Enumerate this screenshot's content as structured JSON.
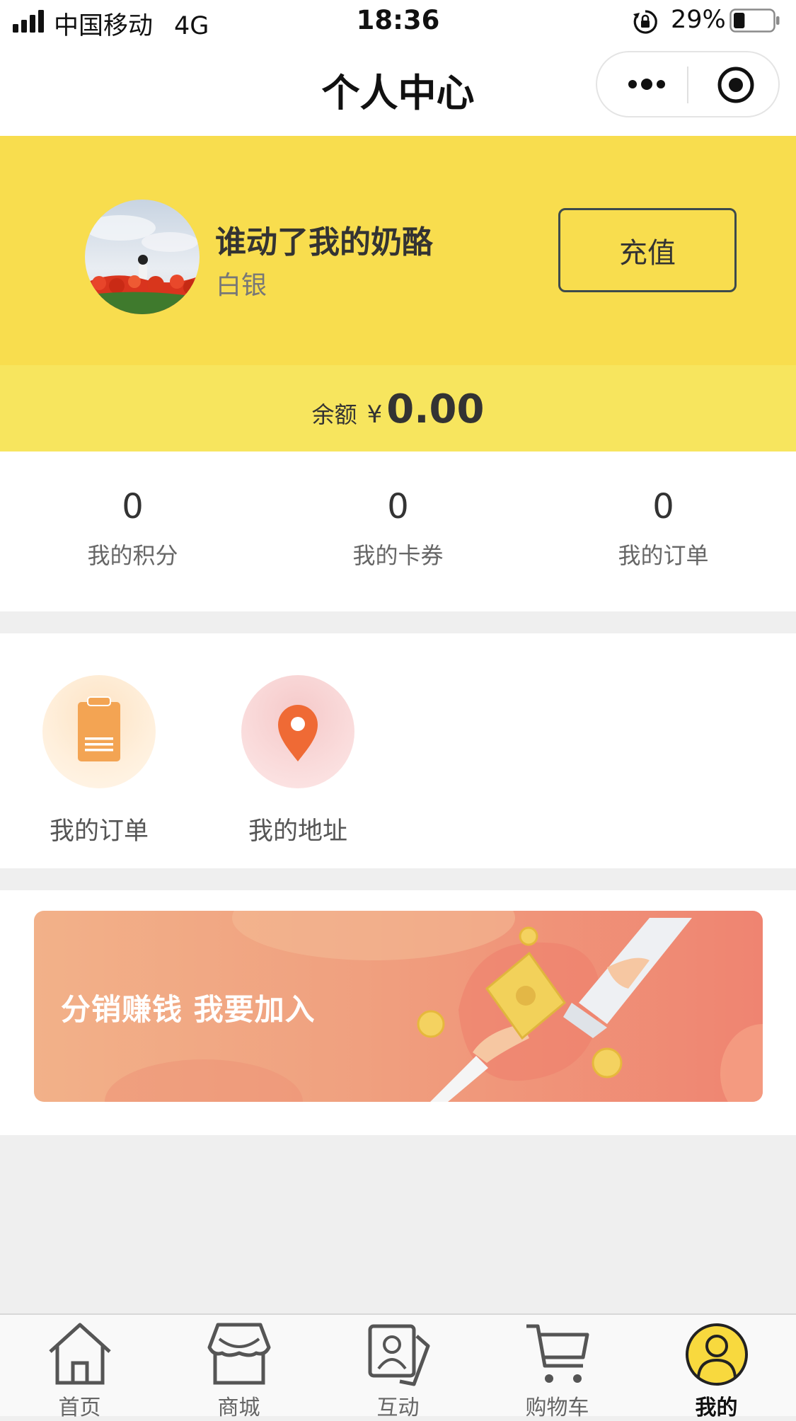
{
  "status_bar": {
    "carrier": "中国移动",
    "network": "4G",
    "time": "18:36",
    "battery": "29%",
    "battery_level": 0.29
  },
  "nav": {
    "title": "个人中心",
    "more_icon": "more-dots-icon",
    "close_icon": "target-circle-icon"
  },
  "profile": {
    "username": "谁动了我的奶酪",
    "level": "白银",
    "recharge_label": "充值",
    "balance_label": "余额",
    "currency": "¥",
    "balance_value": "0.00"
  },
  "stats": [
    {
      "value": "0",
      "label": "我的积分"
    },
    {
      "value": "0",
      "label": "我的卡券"
    },
    {
      "value": "0",
      "label": "我的订单"
    }
  ],
  "shortcuts": [
    {
      "label": "我的订单",
      "icon": "clipboard-icon"
    },
    {
      "label": "我的地址",
      "icon": "location-pin-icon"
    }
  ],
  "banner": {
    "text": "分销赚钱  我要加入"
  },
  "tabs": [
    {
      "label": "首页",
      "icon": "home-icon",
      "active": false
    },
    {
      "label": "商城",
      "icon": "store-icon",
      "active": false
    },
    {
      "label": "互动",
      "icon": "contact-card-icon",
      "active": false
    },
    {
      "label": "购物车",
      "icon": "cart-icon",
      "active": false
    },
    {
      "label": "我的",
      "icon": "user-icon",
      "active": true
    }
  ],
  "colors": {
    "header_yellow": "#f8dd4e",
    "balance_yellow": "#f7e55e",
    "banner_start": "#f2b189",
    "banner_end": "#ef8471",
    "order_icon": "#f3a453",
    "pin_icon": "#ef6a35"
  }
}
